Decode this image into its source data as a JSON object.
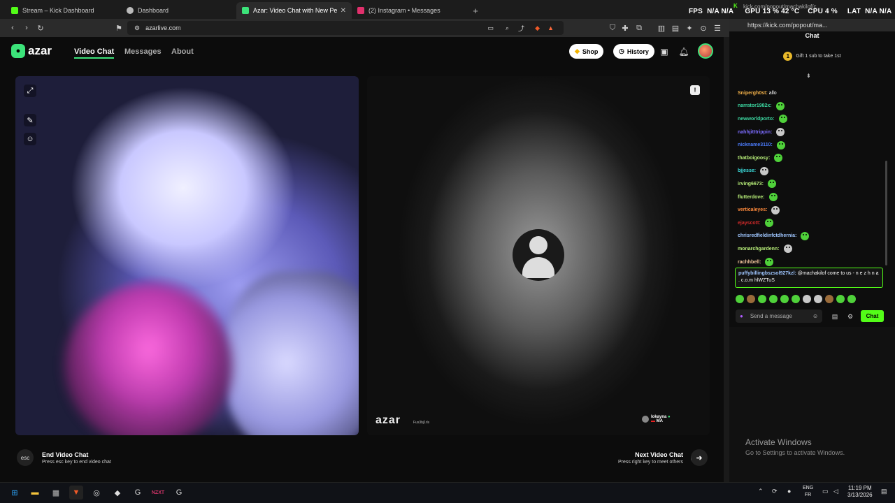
{
  "browser": {
    "tabs": [
      {
        "label": "Stream – Kick Dashboard",
        "color": "#53fc18"
      },
      {
        "label": "Dashboard",
        "color": "#cccccc"
      },
      {
        "label": "Azar: Video Chat with New Pe",
        "color": "#3ce37a",
        "active": true
      },
      {
        "label": "(2) Instagram • Messages",
        "color": "#e1306c"
      }
    ],
    "url": "azarlive.com"
  },
  "azar": {
    "brand": "azar",
    "nav": [
      "Video Chat",
      "Messages",
      "About"
    ],
    "shop_label": "Shop",
    "history_label": "History",
    "watermark": "azar",
    "watermark_sub": "Fus3bj1rls",
    "partner_name": "lokayna",
    "partner_country": "MA",
    "esc_key": "esc",
    "end_title": "End Video Chat",
    "end_sub": "Press esc key to end video chat",
    "next_title": "Next Video Chat",
    "next_sub": "Press right key to meet others"
  },
  "kick": {
    "top_url": "kick.com/popout/machakilof/c...",
    "url": "https://kick.com/popout/ma...",
    "overlay": {
      "fps": "FPS",
      "fps_val": "N/A N/A",
      "gpu": "GPU 13 % 42 °C",
      "cpu": "CPU 4 %",
      "lat": "LAT",
      "lat_val": "N/A N/A"
    },
    "title": "Chat",
    "gift": "Gift 1 sub to take 1st",
    "gift_num": "1",
    "messages": [
      {
        "user": "Snipergh0st:",
        "text": " allo",
        "color": "#f5b34a",
        "emote": false
      },
      {
        "user": "narrator1982x:",
        "text": "",
        "color": "#3cd6a0",
        "emote": true
      },
      {
        "user": "newworldporto:",
        "text": "",
        "color": "#3cd6a0",
        "emote": true
      },
      {
        "user": "nahhjitttrippin:",
        "text": "",
        "color": "#7c6cff",
        "emote": true
      },
      {
        "user": "nickname3110:",
        "text": "",
        "color": "#4c7dff",
        "emote": true
      },
      {
        "user": "thatboigoosy:",
        "text": "",
        "color": "#b9f07a",
        "emote": true
      },
      {
        "user": "bjjesse:",
        "text": "",
        "color": "#3ce0e0",
        "emote": true
      },
      {
        "user": "irving6673:",
        "text": "",
        "color": "#b9f07a",
        "emote": true
      },
      {
        "user": "flutterdove:",
        "text": "",
        "color": "#b9f07a",
        "emote": true
      },
      {
        "user": "verticaleyes:",
        "text": "",
        "color": "#ff8a3c",
        "emote": true
      },
      {
        "user": "ejayscott:",
        "text": "",
        "color": "#d22a2a",
        "emote": true
      },
      {
        "user": "chrisredfieldinfctdhernia:",
        "text": "",
        "color": "#9fc6ff",
        "emote": true
      },
      {
        "user": "monarchgardenn:",
        "text": "",
        "color": "#b9f07a",
        "emote": true
      },
      {
        "user": "rachhbell:",
        "text": "",
        "color": "#f7c9a0",
        "emote": true
      }
    ],
    "highlight_user": "puffybillingbszsol927kzl:",
    "highlight_text": " @machakilof come to us - n e z h n a . c.o.m hlWZTuS",
    "send_placeholder": "Send a message",
    "chat_button": "Chat"
  },
  "desktop": {
    "activate_title": "Activate Windows",
    "activate_sub": "Go to Settings to activate Windows.",
    "lang_top": "ENG",
    "lang_bottom": "FR",
    "time": "11:19 PM",
    "date": "3/13/2026"
  }
}
